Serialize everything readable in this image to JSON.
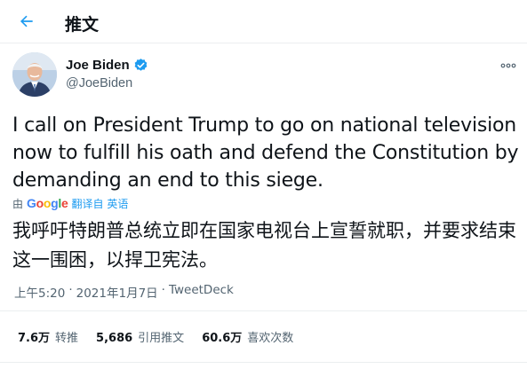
{
  "header": {
    "title": "推文"
  },
  "author": {
    "name": "Joe Biden",
    "handle": "@JoeBiden"
  },
  "tweet": {
    "text": "I call on President Trump to go on national television now to fulfill his oath and defend the Constitution by demanding an end to this siege.",
    "translate_prefix": "由",
    "translate_provider": "Google",
    "translate_action": "翻译自 英语",
    "translated_text": "我呼吁特朗普总统立即在国家电视台上宣誓就职，并要求结束这一围困，以捍卫宪法。",
    "time": "上午5:20",
    "date": "2021年1月7日",
    "source": "TweetDeck",
    "separator": "·"
  },
  "stats": [
    {
      "value": "7.6万",
      "label": "转推"
    },
    {
      "value": "5,686",
      "label": "引用推文"
    },
    {
      "value": "60.6万",
      "label": "喜欢次数"
    }
  ],
  "colors": {
    "accent": "#1d9bf0",
    "text": "#0f1419",
    "secondary": "#536471",
    "divider": "#ebeef0"
  },
  "icons": {
    "back": "arrow-left-icon",
    "verified": "verified-badge-icon",
    "more": "more-horizontal-icon"
  }
}
